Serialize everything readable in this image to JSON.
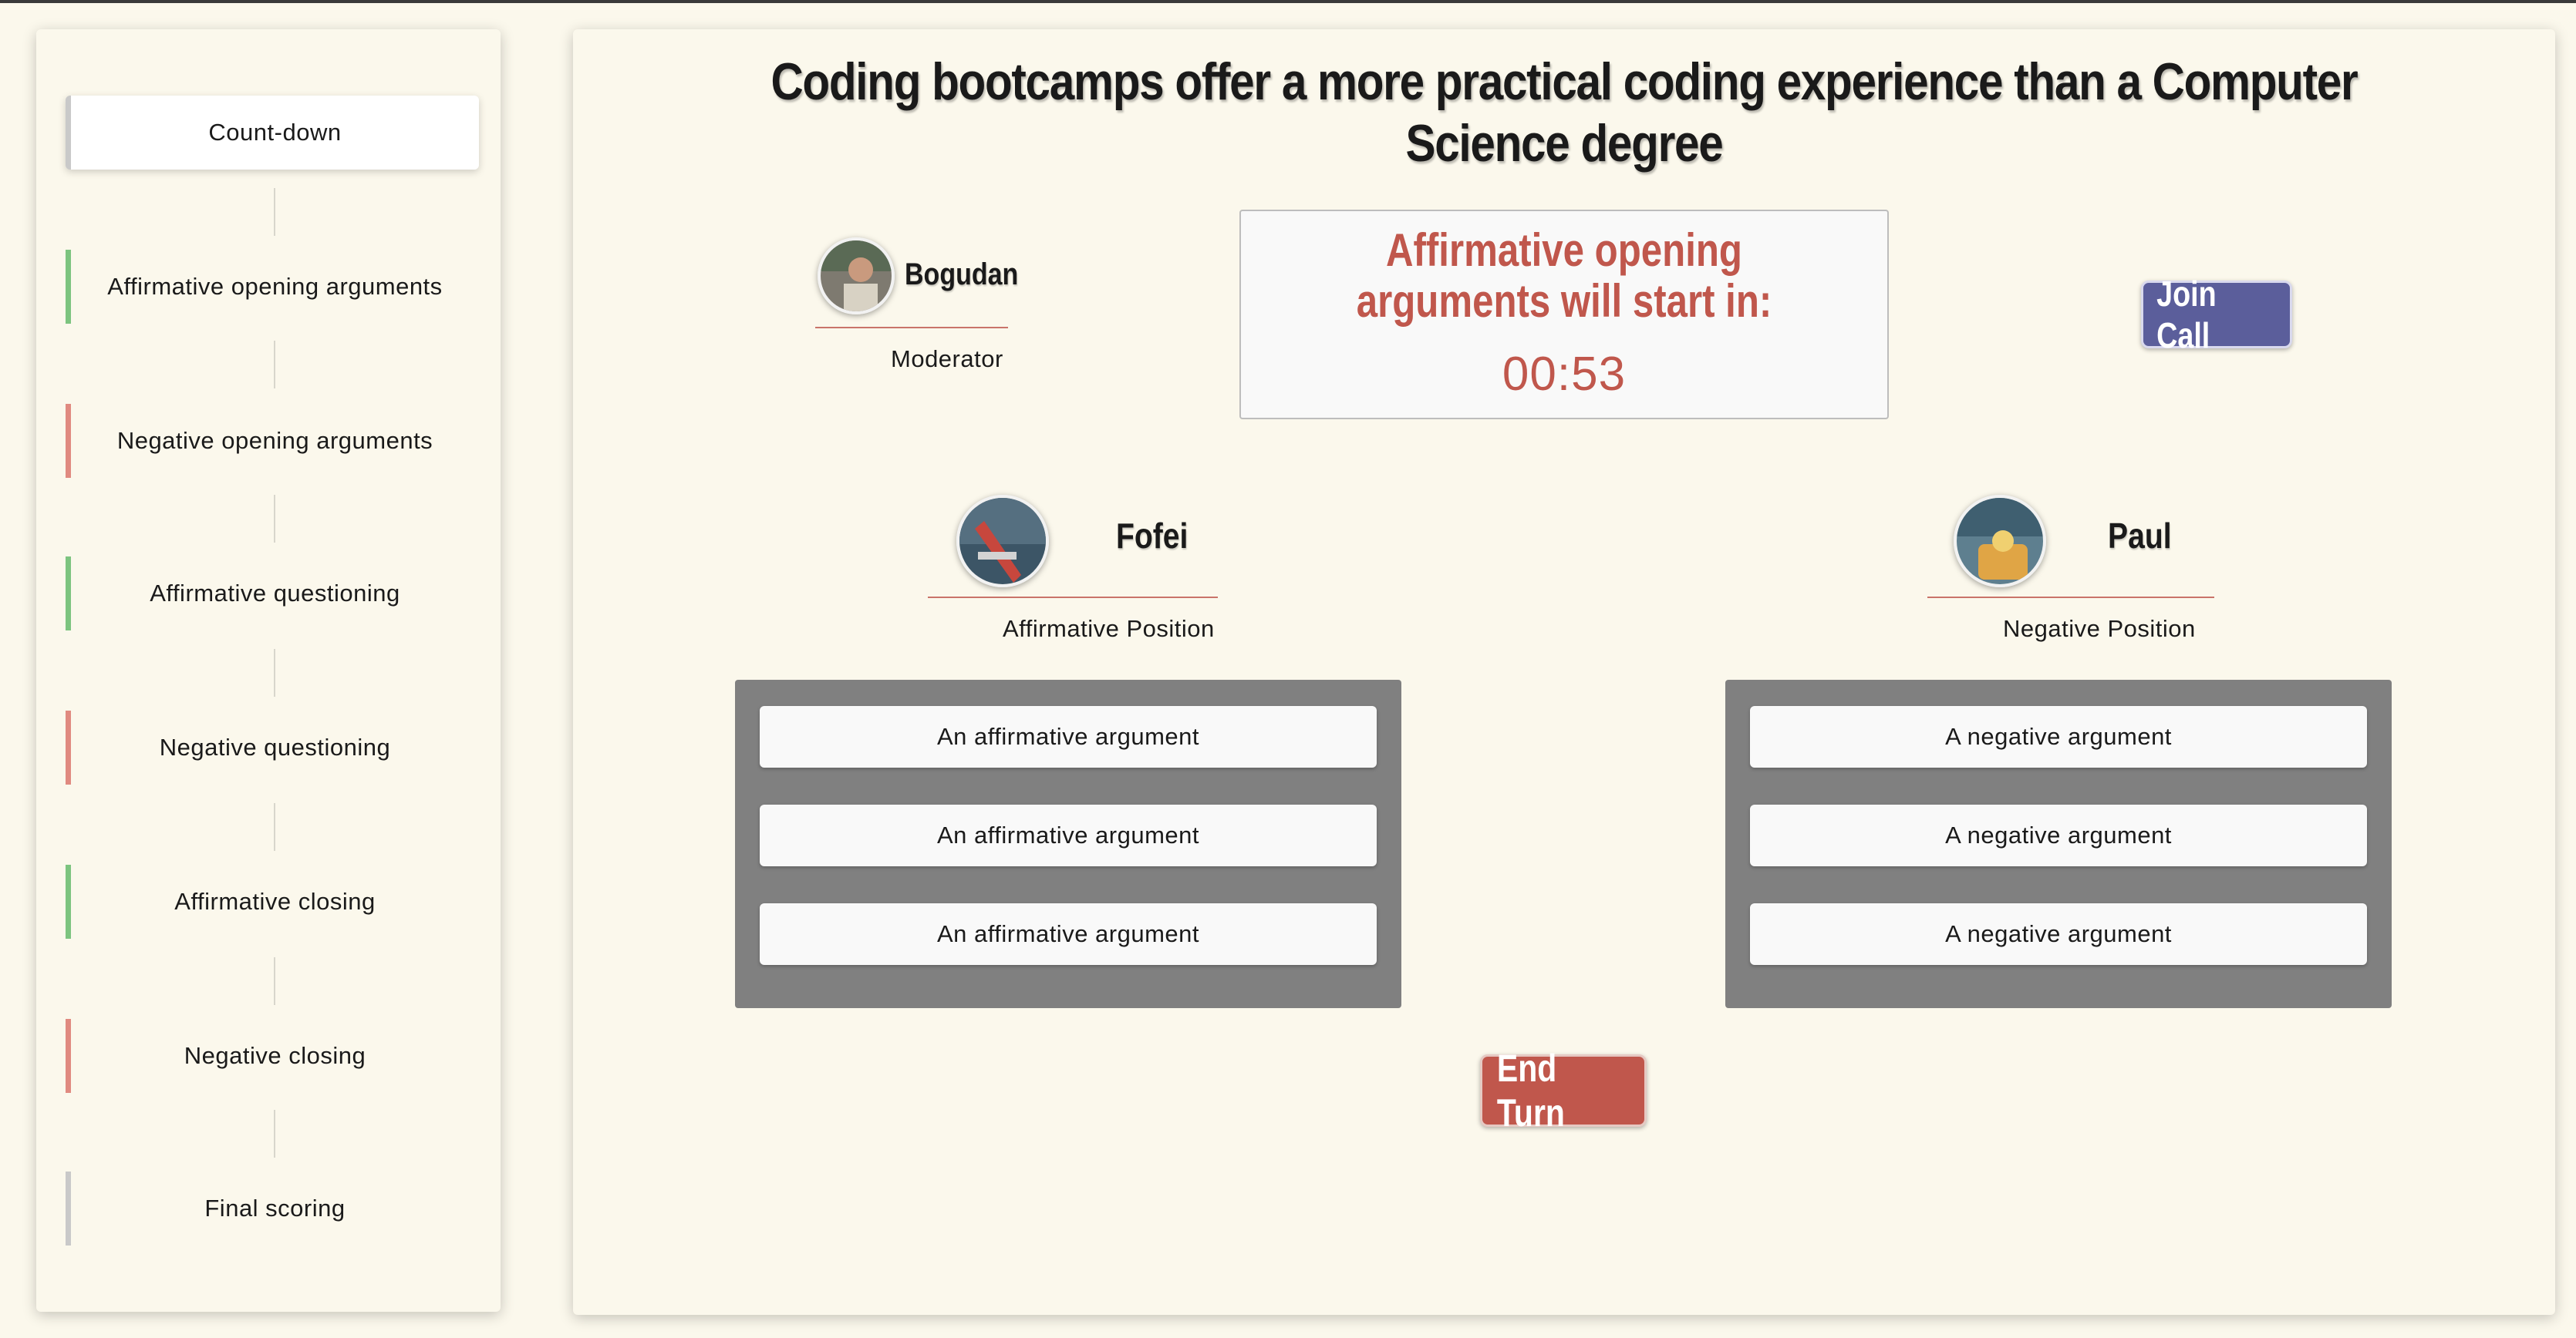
{
  "sidebar": {
    "steps": [
      {
        "label": "Count-down"
      },
      {
        "label": "Affirmative opening arguments"
      },
      {
        "label": "Negative opening arguments"
      },
      {
        "label": "Affirmative questioning"
      },
      {
        "label": "Negative questioning"
      },
      {
        "label": "Affirmative closing"
      },
      {
        "label": "Negative closing"
      },
      {
        "label": "Final scoring"
      }
    ],
    "active_index": 0
  },
  "debate": {
    "title": "Coding bootcamps offer a more practical coding experience than a Computer Science degree"
  },
  "moderator": {
    "name": "Bogudan",
    "role": "Moderator"
  },
  "countdown": {
    "text": "Affirmative opening arguments will start in:",
    "time": "00:53"
  },
  "buttons": {
    "join_call": "Join Call",
    "end_turn": "End Turn"
  },
  "affirmative": {
    "name": "Fofei",
    "role": "Affirmative Position",
    "arguments": [
      "An affirmative argument",
      "An affirmative argument",
      "An affirmative argument"
    ]
  },
  "negative": {
    "name": "Paul",
    "role": "Negative Position",
    "arguments": [
      "A negative argument",
      "A negative argument",
      "A negative argument"
    ]
  },
  "colors": {
    "background": "#fbf8ec",
    "accent_red": "#c0574c",
    "join_blue": "#5b5e9b",
    "affirmative_green": "#7cc47f",
    "negative_red": "#e08a80"
  }
}
